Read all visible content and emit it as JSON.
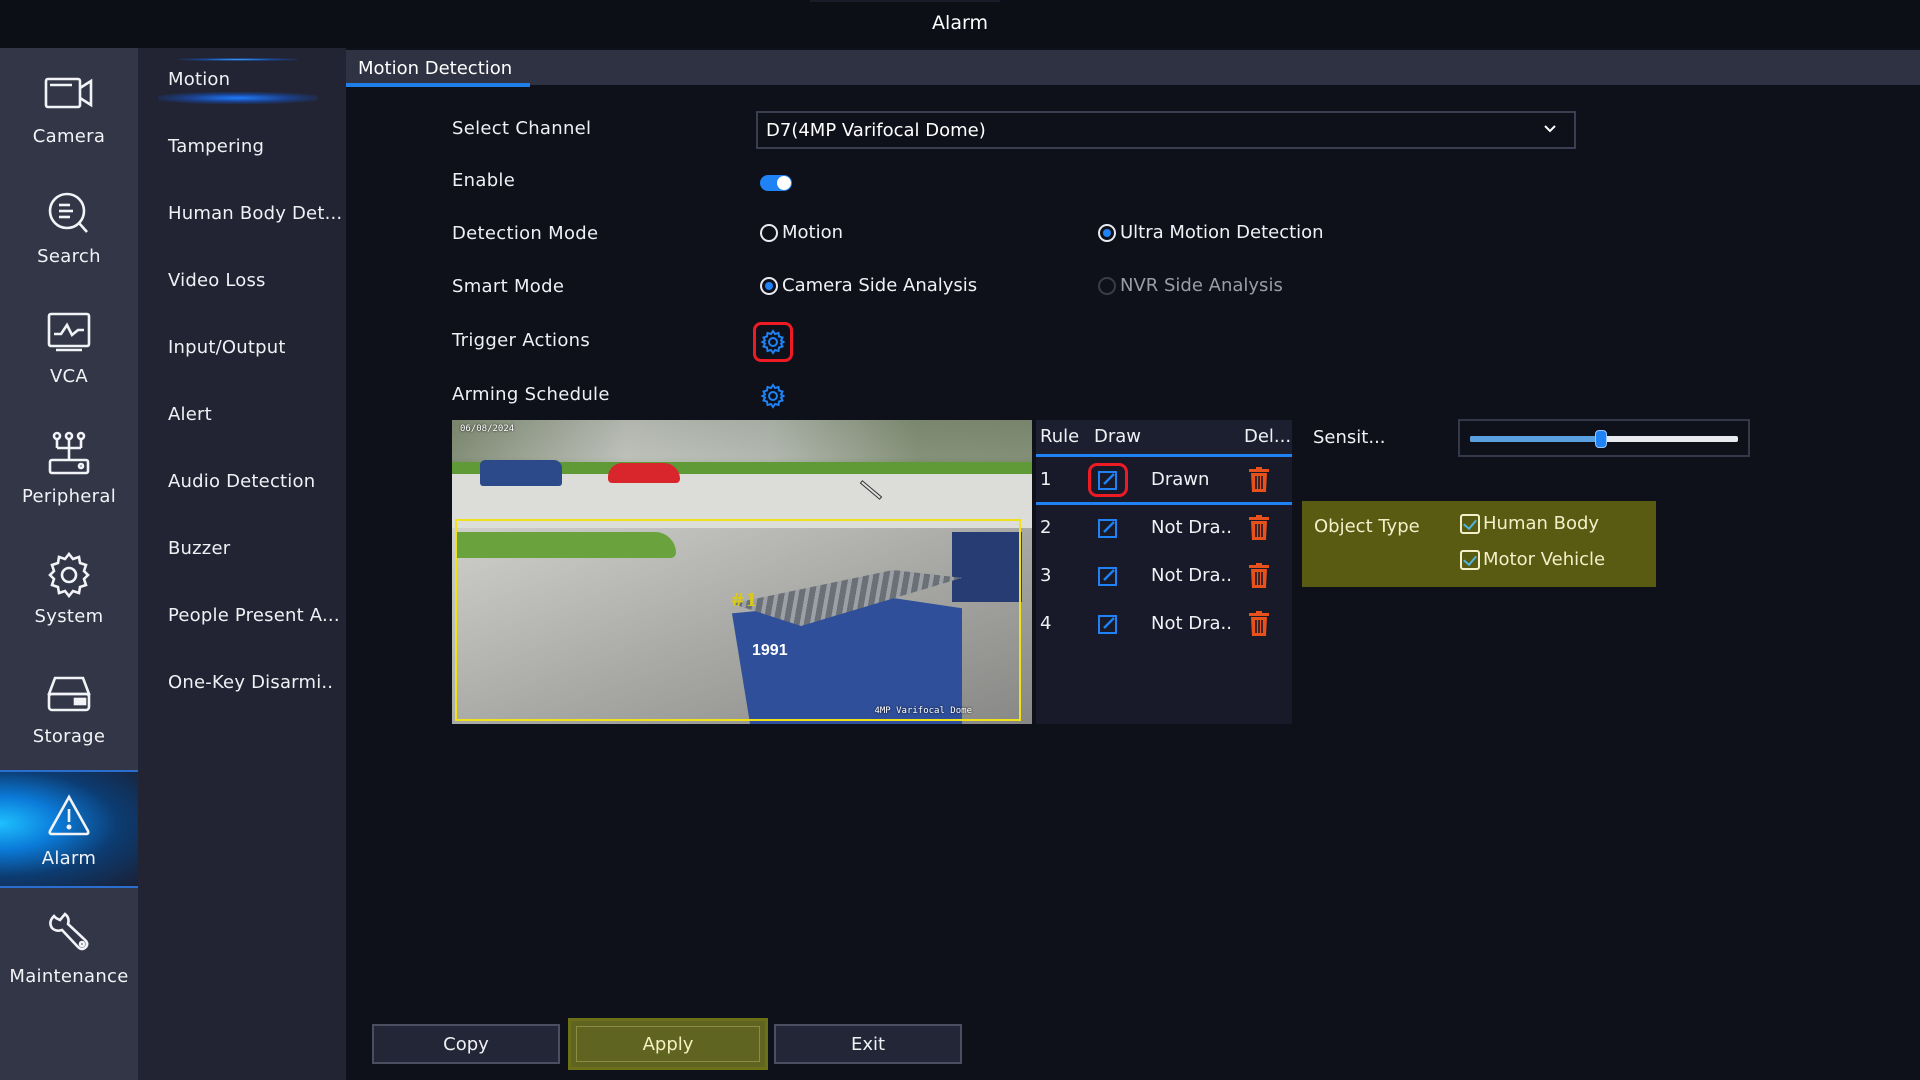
{
  "window": {
    "title": "Alarm"
  },
  "sidebar": {
    "items": [
      {
        "label": "Camera",
        "icon": "camera-icon",
        "active": false
      },
      {
        "label": "Search",
        "icon": "search-icon",
        "active": false
      },
      {
        "label": "VCA",
        "icon": "vca-monitor-icon",
        "active": false
      },
      {
        "label": "Peripheral",
        "icon": "peripheral-icon",
        "active": false
      },
      {
        "label": "System",
        "icon": "gear-icon",
        "active": false
      },
      {
        "label": "Storage",
        "icon": "storage-icon",
        "active": false
      },
      {
        "label": "Alarm",
        "icon": "alarm-warning-icon",
        "active": true
      },
      {
        "label": "Maintenance",
        "icon": "wrench-icon",
        "active": false
      }
    ]
  },
  "submenu": {
    "items": [
      {
        "label": "Motion",
        "active": true
      },
      {
        "label": "Tampering"
      },
      {
        "label": "Human Body Det..."
      },
      {
        "label": "Video Loss"
      },
      {
        "label": "Input/Output"
      },
      {
        "label": "Alert"
      },
      {
        "label": "Audio Detection"
      },
      {
        "label": "Buzzer"
      },
      {
        "label": "People Present A..."
      },
      {
        "label": "One-Key Disarmi.."
      }
    ]
  },
  "main": {
    "tab": "Motion Detection",
    "fields": {
      "select_channel": {
        "label": "Select Channel",
        "value": "D7(4MP Varifocal Dome)"
      },
      "enable": {
        "label": "Enable",
        "value": true
      },
      "detection_mode": {
        "label": "Detection Mode",
        "options": [
          {
            "label": "Motion",
            "selected": false,
            "disabled": false
          },
          {
            "label": "Ultra Motion Detection",
            "selected": true,
            "disabled": false
          }
        ]
      },
      "smart_mode": {
        "label": "Smart Mode",
        "options": [
          {
            "label": "Camera Side Analysis",
            "selected": true,
            "disabled": false
          },
          {
            "label": "NVR Side Analysis",
            "selected": false,
            "disabled": true
          }
        ]
      },
      "trigger_actions": {
        "label": "Trigger Actions",
        "icon": "gear-icon",
        "highlighted": true
      },
      "arming_schedule": {
        "label": "Arming Schedule",
        "icon": "gear-icon"
      }
    },
    "preview": {
      "osd_date": "06/08/2024",
      "osd_camera_name": "4MP Varifocal Dome",
      "roi_label": "#1",
      "bin_number": "1991"
    },
    "rules_table": {
      "columns": [
        "Rule",
        "Draw",
        "Del..."
      ],
      "rows": [
        {
          "rule": "1",
          "state": "Drawn",
          "selected": true,
          "draw_highlighted": true
        },
        {
          "rule": "2",
          "state": "Not Dra..",
          "selected": false,
          "draw_highlighted": false
        },
        {
          "rule": "3",
          "state": "Not Dra..",
          "selected": false,
          "draw_highlighted": false
        },
        {
          "rule": "4",
          "state": "Not Dra..",
          "selected": false,
          "draw_highlighted": false
        }
      ]
    },
    "sensitivity": {
      "label": "Sensit...",
      "value_percent": 49
    },
    "object_type": {
      "label": "Object Type",
      "options": [
        {
          "label": "Human Body",
          "checked": true
        },
        {
          "label": "Motor Vehicle",
          "checked": true
        }
      ]
    },
    "buttons": {
      "copy": "Copy",
      "apply": "Apply",
      "exit": "Exit"
    }
  },
  "colors": {
    "accent": "#1f82f5",
    "highlight_border": "#ee1b24",
    "delete_icon": "#e8501c",
    "object_panel": "#5a5b12",
    "roi_border": "#f0e21a"
  }
}
